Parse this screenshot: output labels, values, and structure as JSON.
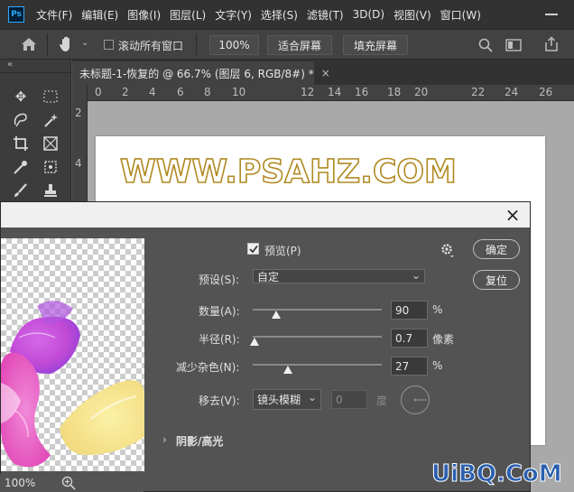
{
  "app": {
    "logo": "Ps",
    "menu": [
      "文件(F)",
      "编辑(E)",
      "图像(I)",
      "图层(L)",
      "文字(Y)",
      "选择(S)",
      "滤镜(T)",
      "3D(D)",
      "视图(V)",
      "窗口(W)"
    ]
  },
  "options_bar": {
    "home_icon": "home-icon",
    "hand_icon": "hand-icon",
    "scroll_all_label": "滚动所有窗口",
    "zoom_value": "100%",
    "fit_screen_label": "适合屏幕",
    "fill_screen_label": "填充屏幕"
  },
  "document_tab": {
    "title": "未标题-1-恢复的 @ 66.7% (图层 6, RGB/8#) *",
    "close": "×"
  },
  "ruler": {
    "horizontal": [
      "0",
      "2",
      "4",
      "6",
      "8",
      "10",
      "12",
      "14",
      "16",
      "18",
      "20",
      "22",
      "24",
      "26"
    ],
    "vertical": [
      "2",
      "4"
    ]
  },
  "canvas": {
    "text": "WWW.PSAHZ.COM"
  },
  "dialog": {
    "close": "×",
    "preview_label": "预览(P)",
    "preview_checked": true,
    "ok_label": "确定",
    "reset_label": "复位",
    "preset_label": "预设(S):",
    "preset_value": "自定",
    "amount_label": "数量(A):",
    "amount_value": "90",
    "amount_unit": "%",
    "radius_label": "半径(R):",
    "radius_value": "0.7",
    "radius_unit": "像素",
    "noise_label": "减少杂色(N):",
    "noise_value": "27",
    "noise_unit": "%",
    "remove_label": "移去(V):",
    "remove_value": "镜头模糊",
    "angle_value": "0",
    "angle_unit": "度",
    "shadow_section": "阴影/高光",
    "zoom_level": "100%"
  },
  "site_watermark": "UiBQ.CoM",
  "colors": {
    "accent": "#31a8ff",
    "text_outline": "#b08a22",
    "watermark_blue": "#2a5fb0"
  }
}
